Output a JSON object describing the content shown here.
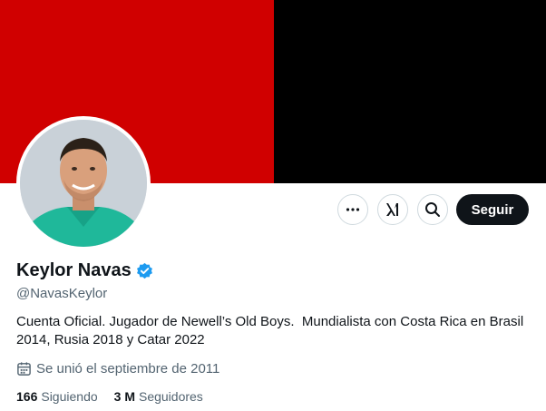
{
  "colors": {
    "banner_left": "#d00000",
    "banner_right": "#000000",
    "verified_badge": "#1d9bf0",
    "follow_button_bg": "#0f1419",
    "secondary_text": "#536471"
  },
  "profile": {
    "display_name": "Keylor Navas",
    "handle": "@NavasKeylor",
    "bio": "Cuenta Oficial. Jugador de Newell’s Old Boys.  Mundialista con Costa Rica en Brasil 2014, Rusia 2018 y Catar 2022",
    "joined": "Se unió el septiembre de 2011",
    "avatar_icon": "profile-photo",
    "verified_icon": "verified-badge-icon"
  },
  "actions": {
    "more_icon": "more-icon",
    "grok_icon": "grok-icon",
    "search_icon": "search-icon",
    "follow_label": "Seguir"
  },
  "stats": {
    "following_count": "166",
    "following_label": "Siguiendo",
    "followers_count": "3 M",
    "followers_label": "Seguidores"
  }
}
